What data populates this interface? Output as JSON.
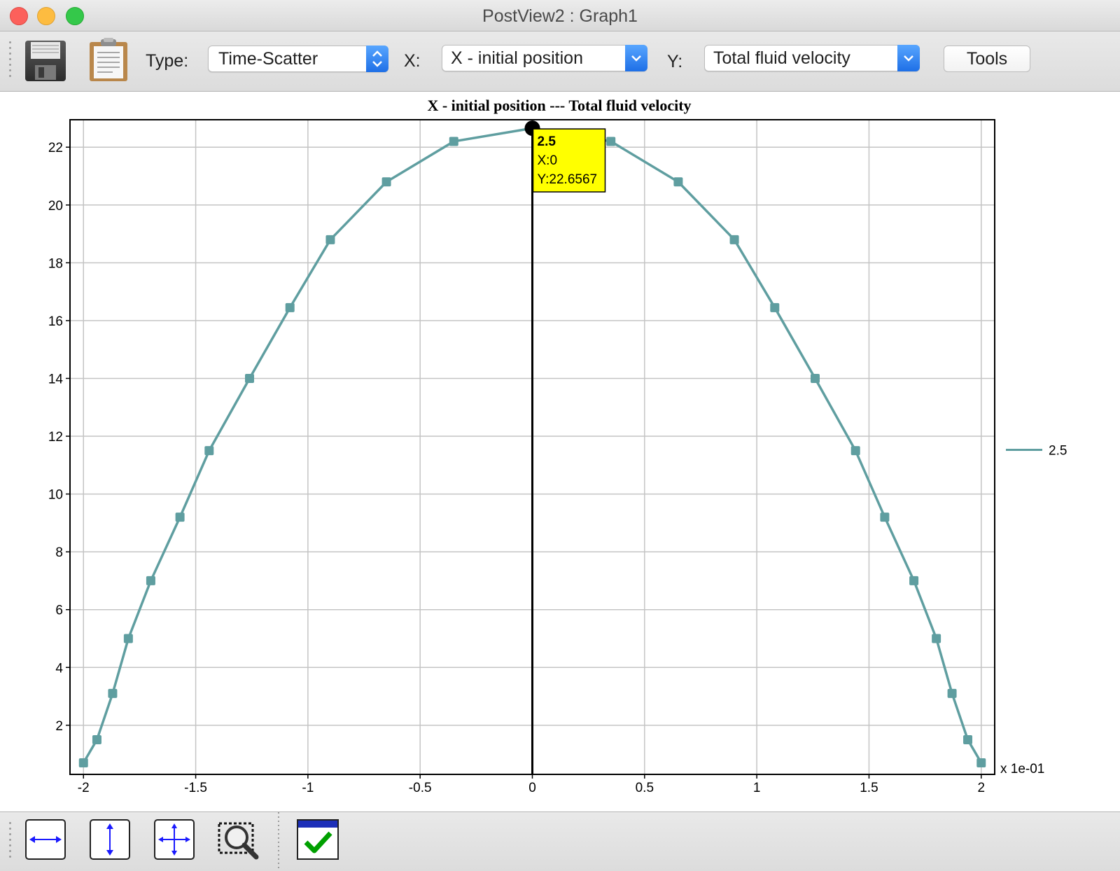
{
  "window": {
    "title": "PostView2 : Graph1"
  },
  "toolbar": {
    "type_label": "Type:",
    "type_value": "Time-Scatter",
    "x_label": "X:",
    "x_value": "X - initial position",
    "y_label": "Y:",
    "y_value": "Total fluid velocity",
    "tools_label": "Tools"
  },
  "colors": {
    "series": "#5f9ea0",
    "tooltip_bg": "#ffff00",
    "accent": "#1e6fe6"
  },
  "chart_data": {
    "type": "line",
    "title": "X - initial position --- Total fluid velocity",
    "xlabel": "",
    "ylabel": "",
    "x_scale_label": "x 1e-01",
    "xlim": [
      -2.06,
      2.06
    ],
    "ylim": [
      0.3,
      22.95
    ],
    "x_ticks": [
      -2,
      -1.5,
      -1,
      -0.5,
      0,
      0.5,
      1,
      1.5,
      2
    ],
    "x_tick_labels": [
      "-2",
      "-1.5",
      "-1",
      "-0.5",
      "0",
      "0.5",
      "1",
      "1.5",
      "2"
    ],
    "y_ticks": [
      2,
      4,
      6,
      8,
      10,
      12,
      14,
      16,
      18,
      20,
      22
    ],
    "y_tick_labels": [
      "2",
      "4",
      "6",
      "8",
      "10",
      "12",
      "14",
      "16",
      "18",
      "20",
      "22"
    ],
    "grid": true,
    "legend_position": "right",
    "series": [
      {
        "name": "2.5",
        "x": [
          -2.0,
          -1.94,
          -1.87,
          -1.8,
          -1.7,
          -1.57,
          -1.44,
          -1.26,
          -1.08,
          -0.9,
          -0.65,
          -0.35,
          0,
          0.35,
          0.65,
          0.9,
          1.08,
          1.26,
          1.44,
          1.57,
          1.7,
          1.8,
          1.87,
          1.94,
          2.0
        ],
        "y": [
          0.7,
          1.5,
          3.1,
          5.0,
          7.0,
          9.2,
          11.5,
          14.0,
          16.45,
          18.8,
          20.8,
          22.2,
          22.6567,
          22.2,
          20.8,
          18.8,
          16.45,
          14.0,
          11.5,
          9.2,
          7.0,
          5.0,
          3.1,
          1.5,
          0.7
        ]
      }
    ],
    "cursor": {
      "x": 0,
      "tooltip_series": "2.5",
      "tooltip_x": "X:0",
      "tooltip_y": "Y:22.6567"
    }
  },
  "bottom_toolbar": {
    "buttons": [
      "zoom-x",
      "zoom-y",
      "zoom-xy",
      "zoom-rect",
      "apply"
    ]
  }
}
